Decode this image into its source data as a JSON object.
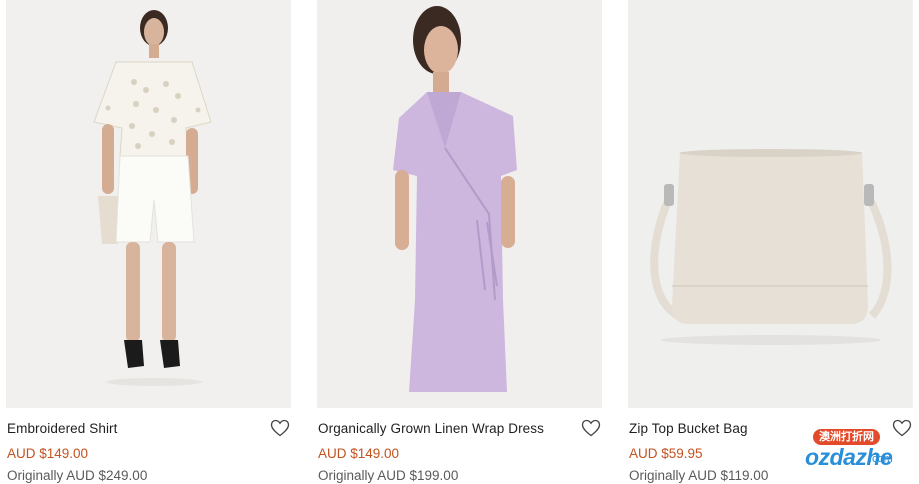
{
  "products": [
    {
      "title": "Embroidered Shirt",
      "price": "AUD $149.00",
      "original_price": "Originally AUD $249.00",
      "wishlist_icon": "heart-outline-icon"
    },
    {
      "title": "Organically Grown Linen Wrap Dress",
      "price": "AUD $149.00",
      "original_price": "Originally AUD $199.00",
      "wishlist_icon": "heart-outline-icon"
    },
    {
      "title": "Zip Top Bucket Bag",
      "price": "AUD $59.95",
      "original_price": "Originally AUD $119.00",
      "wishlist_icon": "heart-outline-icon"
    }
  ],
  "watermark": {
    "badge": "澳洲打折网",
    "logo": "ozdazhe",
    "suffix": ".com"
  },
  "colors": {
    "sale_price": "#c4521f",
    "original_price": "#5a5a5a",
    "image_background": "#f2f1ef"
  }
}
